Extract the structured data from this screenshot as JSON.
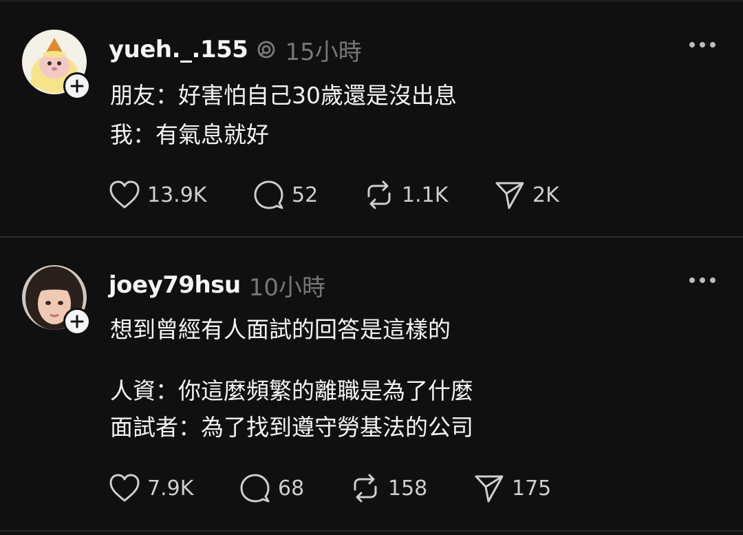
{
  "posts": [
    {
      "username": "yueh._.155",
      "time": "15小時",
      "avatar_icon": "cat-avatar-icon",
      "lines": [
        "朋友：好害怕自己30歲還是沒出息",
        "我：有氣息就好"
      ],
      "likes": "13.9K",
      "replies": "52",
      "reposts": "1.1K",
      "shares": "2K"
    },
    {
      "username": "joey79hsu",
      "time": "10小時",
      "avatar_icon": "person-avatar-icon",
      "lines": [
        "想到曾經有人面試的回答是這樣的",
        "人資：你這麼頻繁的離職是為了什麼",
        "面試者：為了找到遵守勞基法的公司"
      ],
      "likes": "7.9K",
      "replies": "68",
      "reposts": "158",
      "shares": "175"
    }
  ],
  "colors": {
    "background": "#101010",
    "text": "#f3f5f7",
    "muted": "#777777"
  }
}
